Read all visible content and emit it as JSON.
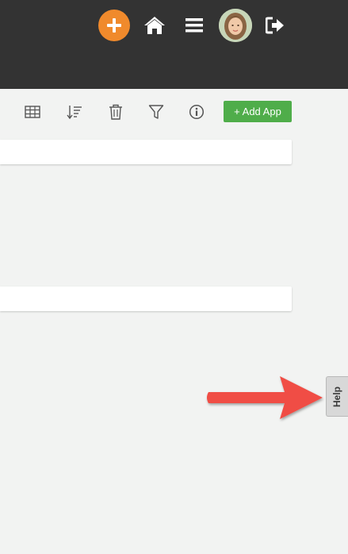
{
  "topbar": {
    "icons": [
      "add-circle-icon",
      "home-icon",
      "menu-icon",
      "avatar",
      "logout-icon"
    ],
    "accent_color": "#f08a2c",
    "background_color": "#333333"
  },
  "toolbar": {
    "icons": [
      "grid-view-icon",
      "sort-icon",
      "trash-icon",
      "filter-icon",
      "info-icon"
    ],
    "add_app_label": "+ Add App",
    "add_app_color": "#4fad4a"
  },
  "help": {
    "label": "Help"
  },
  "annotation": {
    "arrow_color": "#f04e45"
  }
}
